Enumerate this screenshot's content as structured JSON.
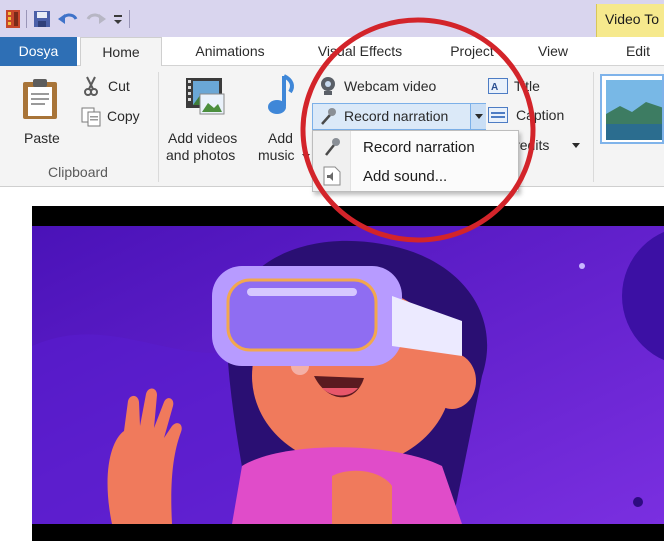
{
  "titlebar": {
    "context_tab": "Video To"
  },
  "tabs": {
    "file": "Dosya",
    "home": "Home",
    "animations": "Animations",
    "visual_effects": "Visual Effects",
    "project": "Project",
    "view": "View",
    "edit": "Edit"
  },
  "clipboard": {
    "paste": "Paste",
    "cut": "Cut",
    "copy": "Copy",
    "group": "Clipboard"
  },
  "add": {
    "videos_line1": "Add videos",
    "videos_line2": "and photos",
    "music_line1": "Add",
    "music_line2": "music"
  },
  "media": {
    "webcam": "Webcam video",
    "record_narration": "Record narration",
    "title": "Title",
    "caption": "Caption",
    "credits": "Credits"
  },
  "dropdown": {
    "items": [
      "Record narration",
      "Add sound..."
    ]
  },
  "colors": {
    "file_tab": "#2e6fb5",
    "context_tab": "#f6e98d",
    "highlight_circle": "#d3242a",
    "video_bg": "#5a1cc7"
  }
}
